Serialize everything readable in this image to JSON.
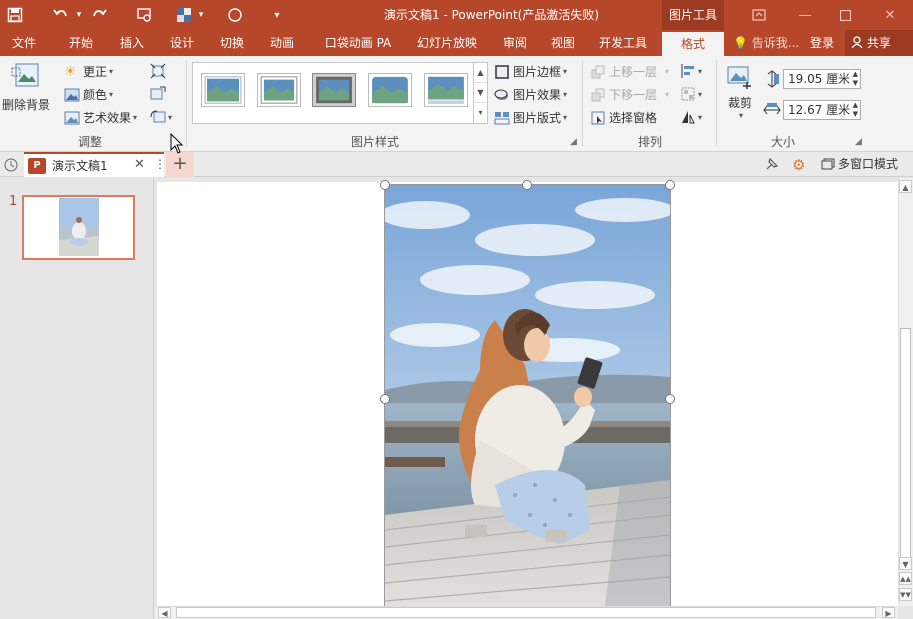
{
  "title_bar": {
    "document_title": "演示文稿1 - PowerPoint(产品激活失败)",
    "contextual_tab": "图片工具",
    "qat_icons": [
      "save-icon",
      "undo-icon",
      "redo-icon",
      "slideshow-from-start-icon",
      "color-picker-icon",
      "oval-shape-icon",
      "customize-qat-icon"
    ],
    "window_buttons": [
      "ribbon-display-options-icon",
      "minimize-icon",
      "maximize-icon",
      "close-icon"
    ]
  },
  "ribbon_tabs": [
    "文件",
    "开始",
    "插入",
    "设计",
    "切换",
    "动画",
    "口袋动画 PA",
    "幻灯片放映",
    "审阅",
    "视图",
    "开发工具",
    "格式"
  ],
  "active_tab": "格式",
  "tell_me": "告诉我...",
  "login": "登录",
  "share": "共享",
  "groups": {
    "adjust": {
      "label": "调整",
      "remove_background": "删除背景",
      "corrections": "更正",
      "color": "颜色",
      "artistic_effects": "艺术效果"
    },
    "picture_styles": {
      "label": "图片样式",
      "picture_border": "图片边框",
      "picture_effects": "图片效果",
      "picture_layout": "图片版式",
      "selected_style_index": 2
    },
    "arrange": {
      "label": "排列",
      "bring_forward": "上移一层",
      "send_backward": "下移一层",
      "selection_pane": "选择窗格"
    },
    "size": {
      "label": "大小",
      "crop": "裁剪",
      "height": "19.05 厘米",
      "width": "12.67 厘米"
    }
  },
  "doc_tab": {
    "badge": "P",
    "label": "演示文稿1",
    "multi_window": "多窗口模式"
  },
  "slides": {
    "current_number": "1"
  },
  "colors": {
    "accent": "#b7472a",
    "accent_dark": "#9c3b22",
    "ribbon_bg": "#f3f3f3",
    "selection_border": "#e07a5f"
  }
}
